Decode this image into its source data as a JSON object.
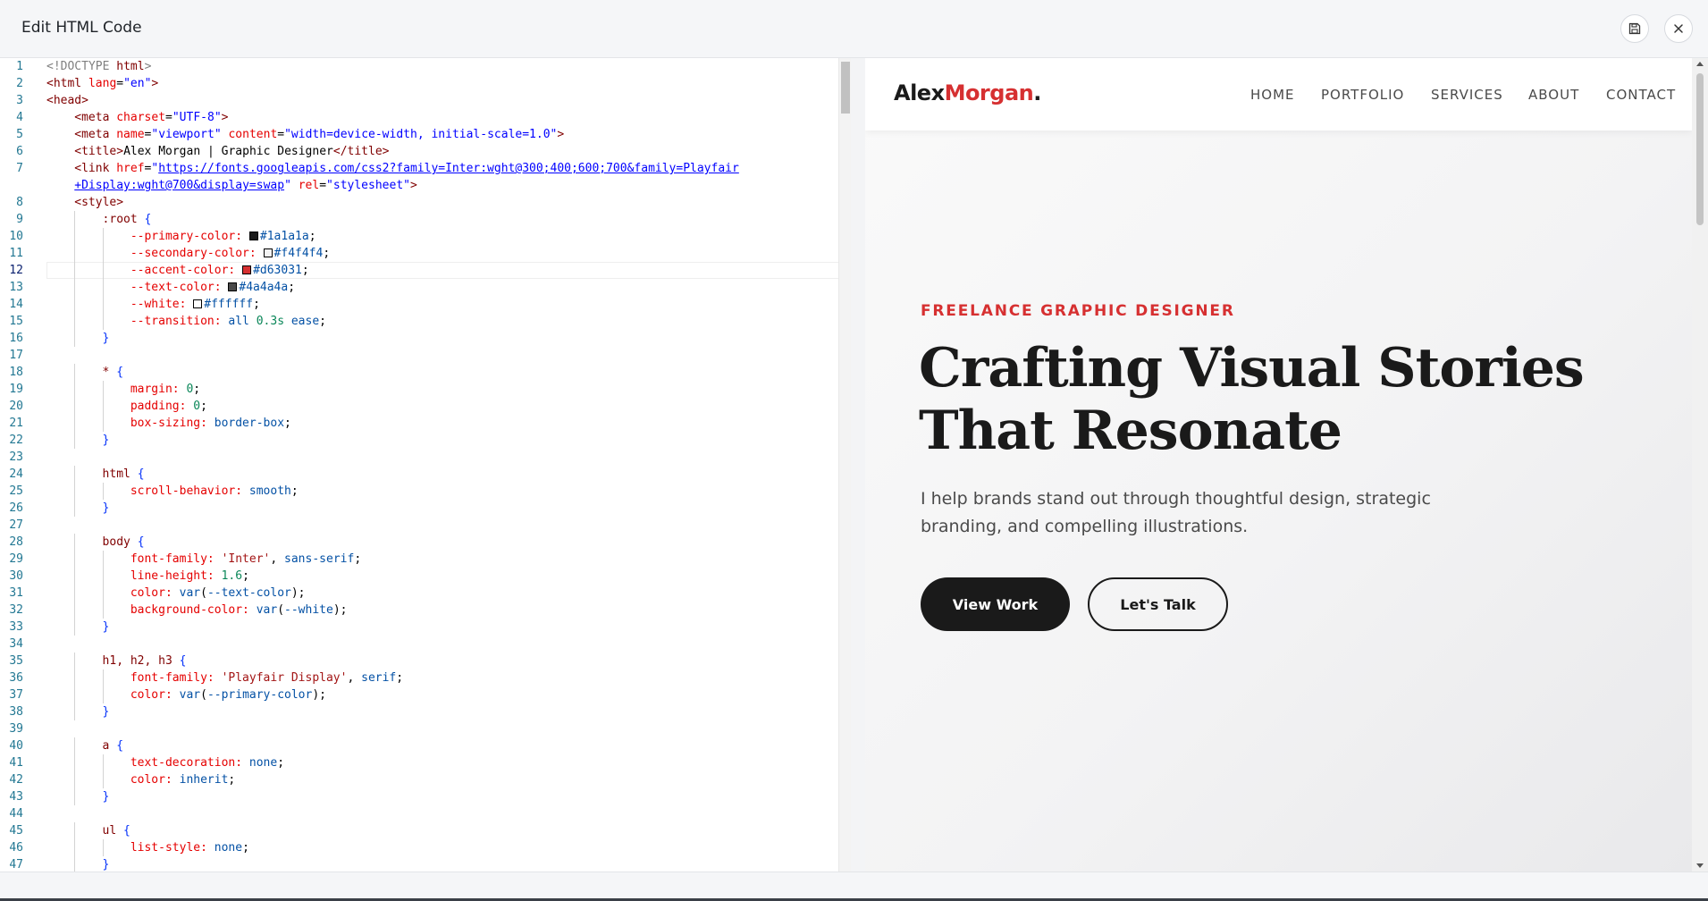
{
  "dialog": {
    "title": "Edit HTML Code"
  },
  "toolbar": {
    "save_icon": "save-icon",
    "close_icon": "close-icon"
  },
  "editor": {
    "active_line": 12,
    "lines": [
      {
        "n": 1,
        "i": 0,
        "t": [
          [
            "com",
            "<!DOCTYPE "
          ],
          [
            "tag",
            "html"
          ],
          [
            "com",
            ">"
          ]
        ]
      },
      {
        "n": 2,
        "i": 0,
        "t": [
          [
            "tag",
            "<html "
          ],
          [
            "attr",
            "lang"
          ],
          [
            "plain",
            "="
          ],
          [
            "val",
            "\"en\""
          ],
          [
            "tag",
            ">"
          ]
        ]
      },
      {
        "n": 3,
        "i": 0,
        "t": [
          [
            "tag",
            "<head>"
          ]
        ]
      },
      {
        "n": 4,
        "i": 1,
        "t": [
          [
            "tag",
            "<meta "
          ],
          [
            "attr",
            "charset"
          ],
          [
            "plain",
            "="
          ],
          [
            "val",
            "\"UTF-8\""
          ],
          [
            "tag",
            ">"
          ]
        ]
      },
      {
        "n": 5,
        "i": 1,
        "t": [
          [
            "tag",
            "<meta "
          ],
          [
            "attr",
            "name"
          ],
          [
            "plain",
            "="
          ],
          [
            "val",
            "\"viewport\""
          ],
          [
            "plain",
            " "
          ],
          [
            "attr",
            "content"
          ],
          [
            "plain",
            "="
          ],
          [
            "val",
            "\"width=device-width, initial-scale=1.0\""
          ],
          [
            "tag",
            ">"
          ]
        ]
      },
      {
        "n": 6,
        "i": 1,
        "t": [
          [
            "tag",
            "<title>"
          ],
          [
            "plain",
            "Alex Morgan | Graphic Designer"
          ],
          [
            "tag",
            "</title>"
          ]
        ]
      },
      {
        "n": 7,
        "i": 1,
        "t": [
          [
            "tag",
            "<link "
          ],
          [
            "attr",
            "href"
          ],
          [
            "plain",
            "="
          ],
          [
            "val",
            "\""
          ],
          [
            "url",
            "https://fonts.googleapis.com/css2?family=Inter:wght@300;400;600;700&family=Playfair"
          ]
        ]
      },
      {
        "n": null,
        "i": 1,
        "t": [
          [
            "url",
            "+Display:wght@700&display=swap"
          ],
          [
            "val",
            "\""
          ],
          [
            "plain",
            " "
          ],
          [
            "attr",
            "rel"
          ],
          [
            "plain",
            "="
          ],
          [
            "val",
            "\"stylesheet\""
          ],
          [
            "tag",
            ">"
          ]
        ]
      },
      {
        "n": 8,
        "i": 1,
        "t": [
          [
            "tag",
            "<style>"
          ]
        ]
      },
      {
        "n": 9,
        "i": 2,
        "t": [
          [
            "sel",
            ":root "
          ],
          [
            "br",
            "{"
          ]
        ]
      },
      {
        "n": 10,
        "i": 3,
        "t": [
          [
            "prop",
            "--primary-color: "
          ],
          [
            "swatch",
            "#1a1a1a"
          ],
          [
            "kw",
            "#1a1a1a"
          ],
          [
            "plain",
            ";"
          ]
        ]
      },
      {
        "n": 11,
        "i": 3,
        "t": [
          [
            "prop",
            "--secondary-color: "
          ],
          [
            "swatch",
            "#f4f4f4"
          ],
          [
            "kw",
            "#f4f4f4"
          ],
          [
            "plain",
            ";"
          ]
        ]
      },
      {
        "n": 12,
        "i": 3,
        "t": [
          [
            "prop",
            "--accent-color: "
          ],
          [
            "swatch",
            "#d63031"
          ],
          [
            "kw",
            "#d63031"
          ],
          [
            "plain",
            ";"
          ]
        ]
      },
      {
        "n": 13,
        "i": 3,
        "t": [
          [
            "prop",
            "--text-color: "
          ],
          [
            "swatch",
            "#4a4a4a"
          ],
          [
            "kw",
            "#4a4a4a"
          ],
          [
            "plain",
            ";"
          ]
        ]
      },
      {
        "n": 14,
        "i": 3,
        "t": [
          [
            "prop",
            "--white: "
          ],
          [
            "swatch",
            "#ffffff"
          ],
          [
            "kw",
            "#ffffff"
          ],
          [
            "plain",
            ";"
          ]
        ]
      },
      {
        "n": 15,
        "i": 3,
        "t": [
          [
            "prop",
            "--transition: "
          ],
          [
            "kw",
            "all "
          ],
          [
            "num",
            "0.3s "
          ],
          [
            "kw",
            "ease"
          ],
          [
            "plain",
            ";"
          ]
        ]
      },
      {
        "n": 16,
        "i": 2,
        "t": [
          [
            "br",
            "}"
          ]
        ]
      },
      {
        "n": 17,
        "i": 0,
        "t": []
      },
      {
        "n": 18,
        "i": 2,
        "t": [
          [
            "sel",
            "* "
          ],
          [
            "br",
            "{"
          ]
        ]
      },
      {
        "n": 19,
        "i": 3,
        "t": [
          [
            "prop",
            "margin: "
          ],
          [
            "num",
            "0"
          ],
          [
            "plain",
            ";"
          ]
        ]
      },
      {
        "n": 20,
        "i": 3,
        "t": [
          [
            "prop",
            "padding: "
          ],
          [
            "num",
            "0"
          ],
          [
            "plain",
            ";"
          ]
        ]
      },
      {
        "n": 21,
        "i": 3,
        "t": [
          [
            "prop",
            "box-sizing: "
          ],
          [
            "kw",
            "border-box"
          ],
          [
            "plain",
            ";"
          ]
        ]
      },
      {
        "n": 22,
        "i": 2,
        "t": [
          [
            "br",
            "}"
          ]
        ]
      },
      {
        "n": 23,
        "i": 0,
        "t": []
      },
      {
        "n": 24,
        "i": 2,
        "t": [
          [
            "sel",
            "html "
          ],
          [
            "br",
            "{"
          ]
        ]
      },
      {
        "n": 25,
        "i": 3,
        "t": [
          [
            "prop",
            "scroll-behavior: "
          ],
          [
            "kw",
            "smooth"
          ],
          [
            "plain",
            ";"
          ]
        ]
      },
      {
        "n": 26,
        "i": 2,
        "t": [
          [
            "br",
            "}"
          ]
        ]
      },
      {
        "n": 27,
        "i": 0,
        "t": []
      },
      {
        "n": 28,
        "i": 2,
        "t": [
          [
            "sel",
            "body "
          ],
          [
            "br",
            "{"
          ]
        ]
      },
      {
        "n": 29,
        "i": 3,
        "t": [
          [
            "prop",
            "font-family: "
          ],
          [
            "str",
            "'Inter'"
          ],
          [
            "plain",
            ", "
          ],
          [
            "kw",
            "sans-serif"
          ],
          [
            "plain",
            ";"
          ]
        ]
      },
      {
        "n": 30,
        "i": 3,
        "t": [
          [
            "prop",
            "line-height: "
          ],
          [
            "num",
            "1.6"
          ],
          [
            "plain",
            ";"
          ]
        ]
      },
      {
        "n": 31,
        "i": 3,
        "t": [
          [
            "prop",
            "color: "
          ],
          [
            "kw",
            "var"
          ],
          [
            "plain",
            "("
          ],
          [
            "kw",
            "--text-color"
          ],
          [
            "plain",
            ");"
          ]
        ]
      },
      {
        "n": 32,
        "i": 3,
        "t": [
          [
            "prop",
            "background-color: "
          ],
          [
            "kw",
            "var"
          ],
          [
            "plain",
            "("
          ],
          [
            "kw",
            "--white"
          ],
          [
            "plain",
            ");"
          ]
        ]
      },
      {
        "n": 33,
        "i": 2,
        "t": [
          [
            "br",
            "}"
          ]
        ]
      },
      {
        "n": 34,
        "i": 0,
        "t": []
      },
      {
        "n": 35,
        "i": 2,
        "t": [
          [
            "sel",
            "h1, h2, h3 "
          ],
          [
            "br",
            "{"
          ]
        ]
      },
      {
        "n": 36,
        "i": 3,
        "t": [
          [
            "prop",
            "font-family: "
          ],
          [
            "str",
            "'Playfair Display'"
          ],
          [
            "plain",
            ", "
          ],
          [
            "kw",
            "serif"
          ],
          [
            "plain",
            ";"
          ]
        ]
      },
      {
        "n": 37,
        "i": 3,
        "t": [
          [
            "prop",
            "color: "
          ],
          [
            "kw",
            "var"
          ],
          [
            "plain",
            "("
          ],
          [
            "kw",
            "--primary-color"
          ],
          [
            "plain",
            ");"
          ]
        ]
      },
      {
        "n": 38,
        "i": 2,
        "t": [
          [
            "br",
            "}"
          ]
        ]
      },
      {
        "n": 39,
        "i": 0,
        "t": []
      },
      {
        "n": 40,
        "i": 2,
        "t": [
          [
            "sel",
            "a "
          ],
          [
            "br",
            "{"
          ]
        ]
      },
      {
        "n": 41,
        "i": 3,
        "t": [
          [
            "prop",
            "text-decoration: "
          ],
          [
            "kw",
            "none"
          ],
          [
            "plain",
            ";"
          ]
        ]
      },
      {
        "n": 42,
        "i": 3,
        "t": [
          [
            "prop",
            "color: "
          ],
          [
            "kw",
            "inherit"
          ],
          [
            "plain",
            ";"
          ]
        ]
      },
      {
        "n": 43,
        "i": 2,
        "t": [
          [
            "br",
            "}"
          ]
        ]
      },
      {
        "n": 44,
        "i": 0,
        "t": []
      },
      {
        "n": 45,
        "i": 2,
        "t": [
          [
            "sel",
            "ul "
          ],
          [
            "br",
            "{"
          ]
        ]
      },
      {
        "n": 46,
        "i": 3,
        "t": [
          [
            "prop",
            "list-style: "
          ],
          [
            "kw",
            "none"
          ],
          [
            "plain",
            ";"
          ]
        ]
      },
      {
        "n": 47,
        "i": 2,
        "t": [
          [
            "br",
            "}"
          ]
        ]
      }
    ]
  },
  "preview": {
    "logo": {
      "first": "Alex",
      "second": "Morgan",
      "dot": "."
    },
    "nav": [
      "HOME",
      "PORTFOLIO",
      "SERVICES",
      "ABOUT",
      "CONTACT"
    ],
    "hero": {
      "eyebrow": "FREELANCE GRAPHIC DESIGNER",
      "title_line1": "Crafting Visual Stories",
      "title_line2": "That Resonate",
      "description": "I help brands stand out through thoughtful design, strategic branding, and compelling illustrations.",
      "primary_button": "View Work",
      "secondary_button": "Let's Talk"
    }
  },
  "colors": {
    "accent": "#d63031",
    "primary": "#1a1a1a",
    "text": "#4a4a4a"
  }
}
